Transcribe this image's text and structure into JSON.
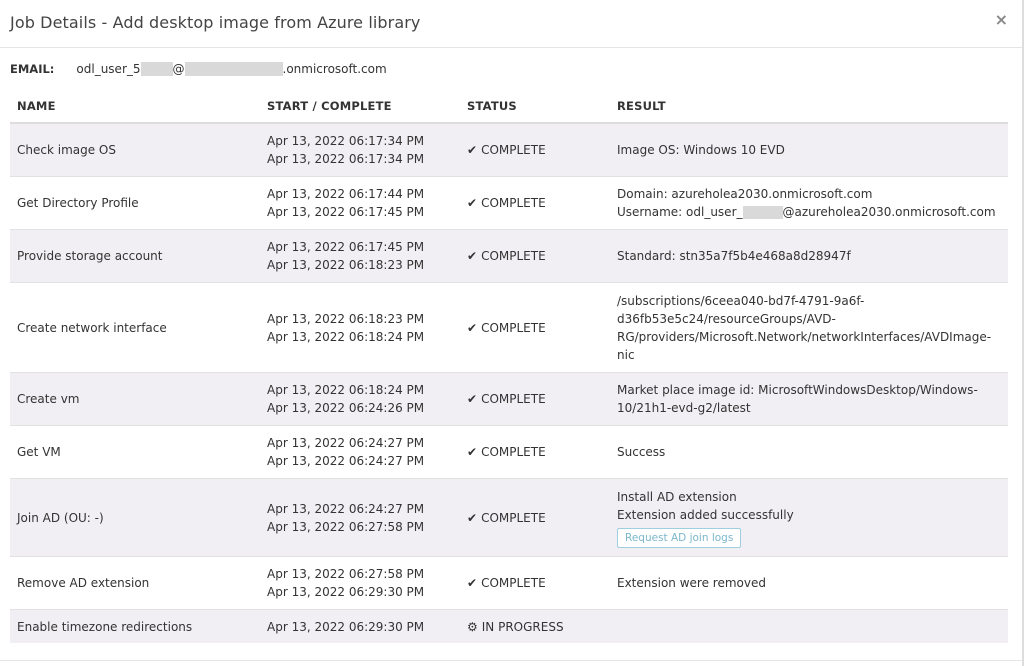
{
  "modal": {
    "title": "Job Details - Add desktop image from Azure library",
    "close_label": "×"
  },
  "email": {
    "label": "EMAIL:",
    "prefix": "odl_user_5",
    "at": "@",
    "suffix": ".onmicrosoft.com"
  },
  "table": {
    "headers": [
      "NAME",
      "START / COMPLETE",
      "STATUS",
      "RESULT"
    ],
    "rows": [
      {
        "name": "Check image OS",
        "start": "Apr 13, 2022 06:17:34 PM",
        "complete": "Apr 13, 2022 06:17:34 PM",
        "status": "COMPLETE",
        "status_icon": "check-icon",
        "result": [
          "Image OS: Windows 10 EVD"
        ]
      },
      {
        "name": "Get Directory Profile",
        "start": "Apr 13, 2022 06:17:44 PM",
        "complete": "Apr 13, 2022 06:17:45 PM",
        "status": "COMPLETE",
        "status_icon": "check-icon",
        "result": [
          "Domain: azureholea2030.onmicrosoft.com"
        ],
        "result_user_prefix": "Username: odl_user_",
        "result_user_suffix": "@azureholea2030.onmicrosoft.com"
      },
      {
        "name": "Provide storage account",
        "start": "Apr 13, 2022 06:17:45 PM",
        "complete": "Apr 13, 2022 06:18:23 PM",
        "status": "COMPLETE",
        "status_icon": "check-icon",
        "result": [
          "Standard: stn35a7f5b4e468a8d28947f"
        ]
      },
      {
        "name": "Create network interface",
        "start": "Apr 13, 2022 06:18:23 PM",
        "complete": "Apr 13, 2022 06:18:24 PM",
        "status": "COMPLETE",
        "status_icon": "check-icon",
        "result": [
          "/subscriptions/6ceea040-bd7f-4791-9a6f-",
          "d36fb53e5c24/resourceGroups/AVD-",
          "RG/providers/Microsoft.Network/networkInterfaces/AVDImage-",
          "nic"
        ]
      },
      {
        "name": "Create vm",
        "start": "Apr 13, 2022 06:18:24 PM",
        "complete": "Apr 13, 2022 06:24:26 PM",
        "status": "COMPLETE",
        "status_icon": "check-icon",
        "result": [
          "Market place image id: MicrosoftWindowsDesktop/Windows-",
          "10/21h1-evd-g2/latest"
        ]
      },
      {
        "name": "Get VM",
        "start": "Apr 13, 2022 06:24:27 PM",
        "complete": "Apr 13, 2022 06:24:27 PM",
        "status": "COMPLETE",
        "status_icon": "check-icon",
        "result": [
          "Success"
        ]
      },
      {
        "name": "Join AD (OU: -)",
        "start": "Apr 13, 2022 06:24:27 PM",
        "complete": "Apr 13, 2022 06:27:58 PM",
        "status": "COMPLETE",
        "status_icon": "check-icon",
        "result": [
          "Install AD extension",
          "Extension added successfully"
        ],
        "action_label": "Request AD join logs"
      },
      {
        "name": "Remove AD extension",
        "start": "Apr 13, 2022 06:27:58 PM",
        "complete": "Apr 13, 2022 06:29:30 PM",
        "status": "COMPLETE",
        "status_icon": "check-icon",
        "result": [
          "Extension were removed"
        ]
      },
      {
        "name": "Enable timezone redirections",
        "start": "Apr 13, 2022 06:29:30 PM",
        "complete": "",
        "status": "IN PROGRESS",
        "status_icon": "gear-icon",
        "result": []
      }
    ]
  }
}
